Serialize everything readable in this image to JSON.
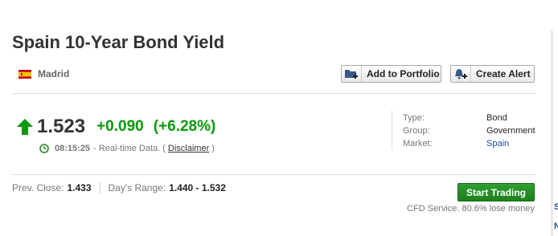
{
  "header": {
    "title": "Spain 10-Year Bond Yield",
    "location": "Madrid"
  },
  "actions": {
    "add_portfolio_label": "Add to Portfolio",
    "create_alert_label": "Create Alert"
  },
  "quote": {
    "last": "1.523",
    "change": "+0.090",
    "change_pct": "(+6.28%)",
    "time": "08:15:25",
    "data_text": "- Real-time Data. (",
    "disclaimer_label": "Disclaimer",
    "close_paren": ")"
  },
  "info": [
    {
      "label": "Type:",
      "value": "Bond"
    },
    {
      "label": "Group:",
      "value": "Government"
    },
    {
      "label": "Market:",
      "value": "Spain"
    }
  ],
  "stats": {
    "prev_close_label": "Prev. Close:",
    "prev_close_value": "1.433",
    "days_range_label": "Day's Range:",
    "days_range_value": "1.440 - 1.532"
  },
  "trading": {
    "button_label": "Start Trading",
    "cfd_note": "CFD Service. 80.6% lose money"
  },
  "edge": {
    "fragment_1": "S",
    "fragment_2": "N"
  },
  "colors": {
    "positive": "#0a9a0a",
    "button_green": "#1d7f1d",
    "link": "#1a4a9a"
  },
  "icons": {
    "flag": "spain-flag-icon",
    "portfolio": "portfolio-add-icon",
    "alert": "bell-plus-icon",
    "trend": "arrow-up-icon",
    "time": "clock-icon"
  }
}
